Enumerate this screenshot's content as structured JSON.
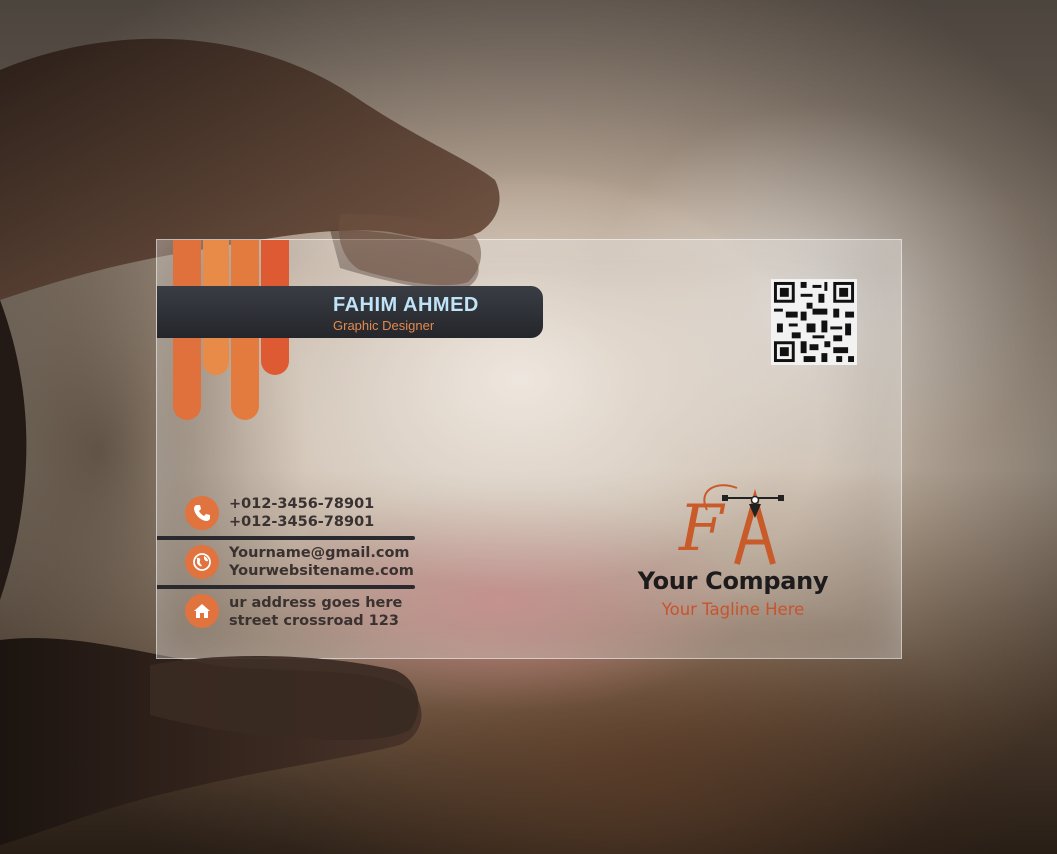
{
  "card": {
    "name": "FAHIM AHMED",
    "role": "Graphic Designer",
    "phone_1": "+012-3456-78901",
    "phone_2": "+012-3456-78901",
    "email": "Yourname@gmail.com",
    "website": "Yourwebsitename.com",
    "address_1": "ur address goes here",
    "address_2": "street crossroad 123",
    "company": "Your Company",
    "tagline": "Your Tagline Here",
    "logo_letters": "FA"
  },
  "icons": {
    "phone": "phone-icon",
    "web": "globe-icon",
    "address": "home-icon",
    "qr": "qr-code"
  },
  "colors": {
    "accent_orange": "#e0733e",
    "dark_bar": "#2a2c31",
    "name_text": "#bfe3f7",
    "tagline": "#c7542e"
  }
}
